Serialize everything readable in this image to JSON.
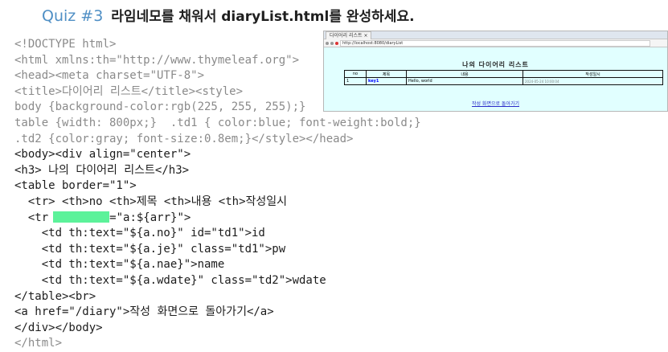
{
  "title": {
    "quiz": "Quiz #3",
    "task": "라임네모를 채워서 diaryList.html를 완성하세요."
  },
  "code": {
    "l1": "<!DOCTYPE html>",
    "l2": "<html xmlns:th=\"http://www.thymeleaf.org\">",
    "l3": "<head><meta charset=\"UTF-8\">",
    "l4": "<title>다이어리 리스트</title><style>",
    "l5": "body {background-color:rgb(225, 255, 255);}",
    "l6": "table {width: 800px;}  .td1 { color:blue; font-weight:bold;}",
    "l7": ".td2 {color:gray; font-size:0.8em;}</style></head>",
    "l8": "<body><div align=\"center\">",
    "l9": "<h3> 나의 다이어리 리스트</h3>",
    "l10": "<table border=\"1\">",
    "l11": "  <tr> <th>no <th>제목 <th>내용 <th>작성일시",
    "l12a": "  <tr",
    "l12b": "=\"a:${arr}\">",
    "l13": "    <td th:text=\"${a.no}\" id=\"td1\">id",
    "l14": "    <td th:text=\"${a.je}\" class=\"td1\">pw",
    "l15": "    <td th:text=\"${a.nae}\">name",
    "l16": "    <td th:text=\"${a.wdate}\" class=\"td2\">wdate",
    "l17": "</table><br>",
    "l18": "<a href=\"/diary\">작성 화면으로 돌아가기</a>",
    "l19": "</div></body>",
    "l20": "</html>"
  },
  "browser": {
    "tab": "다이어리 리스트 ×",
    "url": "http://localhost:8080/diaryList",
    "heading": "나의 다이어리 리스트",
    "headers": [
      "no",
      "제목",
      "내용",
      "작성일시"
    ],
    "row": [
      "1",
      "key1",
      "Hello, world",
      "2024-05-24 10:00:04"
    ],
    "link": "작성 화면으로 돌아가기"
  },
  "colors": {
    "quiz": "#4f8fc5",
    "blank": "#5cf29a",
    "page_bg": "#e1ffff"
  }
}
